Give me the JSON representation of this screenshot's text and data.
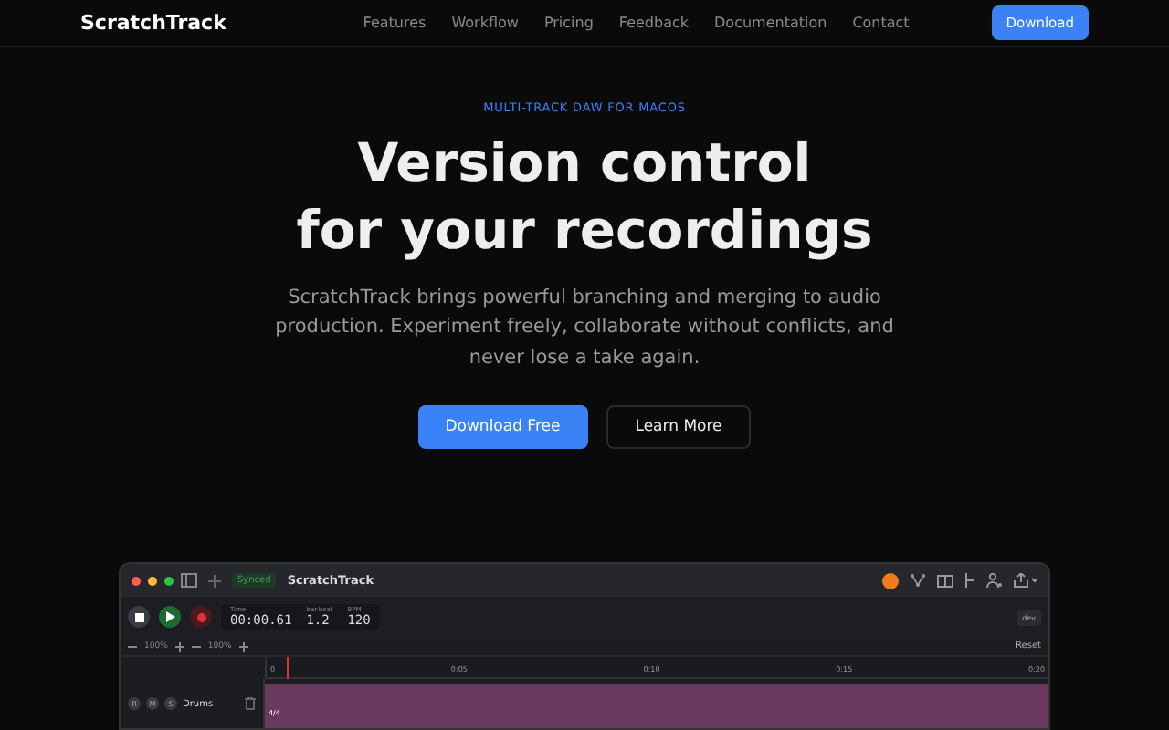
{
  "nav": {
    "brand": "ScratchTrack",
    "links": [
      "Features",
      "Workflow",
      "Pricing",
      "Feedback",
      "Documentation",
      "Contact"
    ],
    "cta": "Download"
  },
  "hero": {
    "eyebrow": "MULTI-TRACK DAW FOR MACOS",
    "title_lines": [
      "Version control",
      "for your recordings"
    ],
    "body": "ScratchTrack brings powerful branching and merging to audio production. Experiment freely, collaborate without conflicts, and never lose a take again.",
    "buttons": [
      {
        "label": "Download Free",
        "kind": "primary"
      },
      {
        "label": "Learn More",
        "kind": "secondary"
      }
    ]
  },
  "app": {
    "status": "Synced",
    "title": "ScratchTrack",
    "readouts": [
      {
        "label": "Time",
        "value": "00:00.61"
      },
      {
        "label": "bar.beat",
        "value": "1.2"
      },
      {
        "label": "BPM",
        "value": "120"
      }
    ],
    "branch": "dev",
    "zooms": [
      "100%",
      "100%"
    ],
    "reset": "Reset",
    "ruler": [
      "0",
      "0:05",
      "0:10",
      "0:15",
      "0:20"
    ],
    "tracks": [
      {
        "name": "Drums",
        "buttons": [
          "R",
          "M",
          "S"
        ],
        "clip": "4/4"
      }
    ]
  }
}
